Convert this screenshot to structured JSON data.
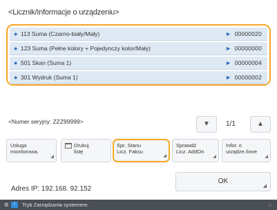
{
  "title": "<Licznik/Informacje o urządzeniu>",
  "counters": [
    {
      "label": "113  Suma (Czarno-biały/Mały)",
      "value": "00000020"
    },
    {
      "label": "123  Suma (Pełne kolory + Pojedynczy kolor/Mały)",
      "value": "00000000"
    },
    {
      "label": "501  Skan (Suma 1)",
      "value": "00000004"
    },
    {
      "label": "301  Wydruk (Suma 1)",
      "value": "00000002"
    }
  ],
  "serial_label": "<Numer seryjny: ZZZ99999>",
  "pager": {
    "page": "1/1"
  },
  "buttons": {
    "monitoring": [
      "Usługa",
      "monitorowa."
    ],
    "print_list": [
      "Drukuj",
      "listę"
    ],
    "check_counter": [
      "Spr. Stanu",
      "Licz. Faksu"
    ],
    "addon_counter": [
      "Sprawdź",
      "Licz. AddOn"
    ],
    "device_info": [
      "Infor. o",
      "urządze./inne"
    ]
  },
  "ip_text": "Adres IP: 192.168. 92.152",
  "ok_label": "OK",
  "status_text": "Tryb Zarządzania systemem.",
  "colors": {
    "accent": "#f5a623",
    "row_bg": "#dfe9f3",
    "status_bg": "#4a4f55"
  },
  "icons": [
    "bullet-icon",
    "arrow-right-icon",
    "arrow-up-icon",
    "arrow-down-icon",
    "print-icon",
    "corner-arrow-icon"
  ]
}
